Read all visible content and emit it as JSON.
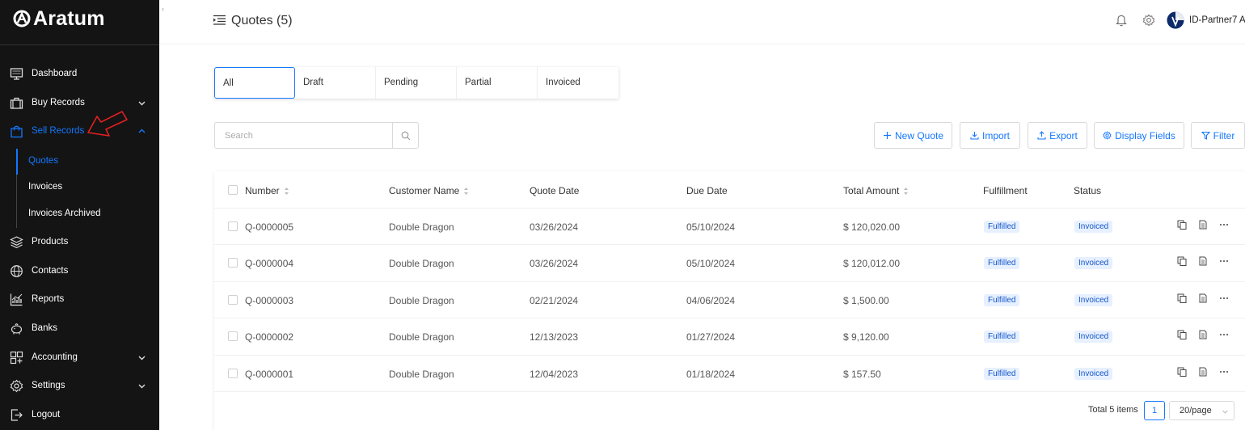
{
  "app": {
    "logo_text": "Aratum"
  },
  "sidebar": {
    "items": [
      {
        "key": "dashboard",
        "label": "Dashboard",
        "icon": "monitor-icon"
      },
      {
        "key": "buy-records",
        "label": "Buy Records",
        "icon": "briefcase-icon",
        "expandable": true
      },
      {
        "key": "sell-records",
        "label": "Sell Records",
        "icon": "shopping-bag-icon",
        "expandable": true,
        "active": true
      },
      {
        "key": "products",
        "label": "Products",
        "icon": "layers-icon"
      },
      {
        "key": "contacts",
        "label": "Contacts",
        "icon": "globe-icon"
      },
      {
        "key": "reports",
        "label": "Reports",
        "icon": "chart-icon"
      },
      {
        "key": "banks",
        "label": "Banks",
        "icon": "piggy-bank-icon"
      },
      {
        "key": "accounting",
        "label": "Accounting",
        "icon": "grid-icon",
        "expandable": true
      },
      {
        "key": "settings",
        "label": "Settings",
        "icon": "gear-icon",
        "expandable": true
      },
      {
        "key": "logout",
        "label": "Logout",
        "icon": "logout-icon"
      }
    ],
    "subitems": [
      {
        "label": "Quotes",
        "active": true
      },
      {
        "label": "Invoices"
      },
      {
        "label": "Invoices Archived"
      }
    ]
  },
  "header": {
    "title": "Quotes (5)",
    "user_name": "ID-Partner7 A..."
  },
  "tabs": [
    {
      "label": "All",
      "active": true
    },
    {
      "label": "Draft"
    },
    {
      "label": "Pending"
    },
    {
      "label": "Partial"
    },
    {
      "label": "Invoiced"
    }
  ],
  "search": {
    "placeholder": "Search",
    "value": ""
  },
  "toolbar": {
    "new_quote": "New Quote",
    "import": "Import",
    "export": "Export",
    "display_fields": "Display Fields",
    "filter": "Filter"
  },
  "table": {
    "columns": {
      "number": "Number",
      "customer": "Customer Name",
      "quote_date": "Quote Date",
      "due_date": "Due Date",
      "total": "Total Amount",
      "fulfillment": "Fulfillment",
      "status": "Status"
    },
    "rows": [
      {
        "number": "Q-0000005",
        "customer": "Double Dragon",
        "quote_date": "03/26/2024",
        "due_date": "05/10/2024",
        "total": "$ 120,020.00",
        "fulfillment": "Fulfilled",
        "status": "Invoiced"
      },
      {
        "number": "Q-0000004",
        "customer": "Double Dragon",
        "quote_date": "03/26/2024",
        "due_date": "05/10/2024",
        "total": "$ 120,012.00",
        "fulfillment": "Fulfilled",
        "status": "Invoiced"
      },
      {
        "number": "Q-0000003",
        "customer": "Double Dragon",
        "quote_date": "02/21/2024",
        "due_date": "04/06/2024",
        "total": "$ 1,500.00",
        "fulfillment": "Fulfilled",
        "status": "Invoiced"
      },
      {
        "number": "Q-0000002",
        "customer": "Double Dragon",
        "quote_date": "12/13/2023",
        "due_date": "01/27/2024",
        "total": "$ 9,120.00",
        "fulfillment": "Fulfilled",
        "status": "Invoiced"
      },
      {
        "number": "Q-0000001",
        "customer": "Double Dragon",
        "quote_date": "12/04/2023",
        "due_date": "01/18/2024",
        "total": "$ 157.50",
        "fulfillment": "Fulfilled",
        "status": "Invoiced"
      }
    ]
  },
  "pagination": {
    "total_text": "Total 5 items",
    "current_page": "1",
    "page_size": "20/page"
  },
  "colors": {
    "sidebar_bg": "#141414",
    "accent": "#1677ff",
    "badge_bg": "#e6f0ff",
    "annotation_arrow": "#e02020"
  }
}
